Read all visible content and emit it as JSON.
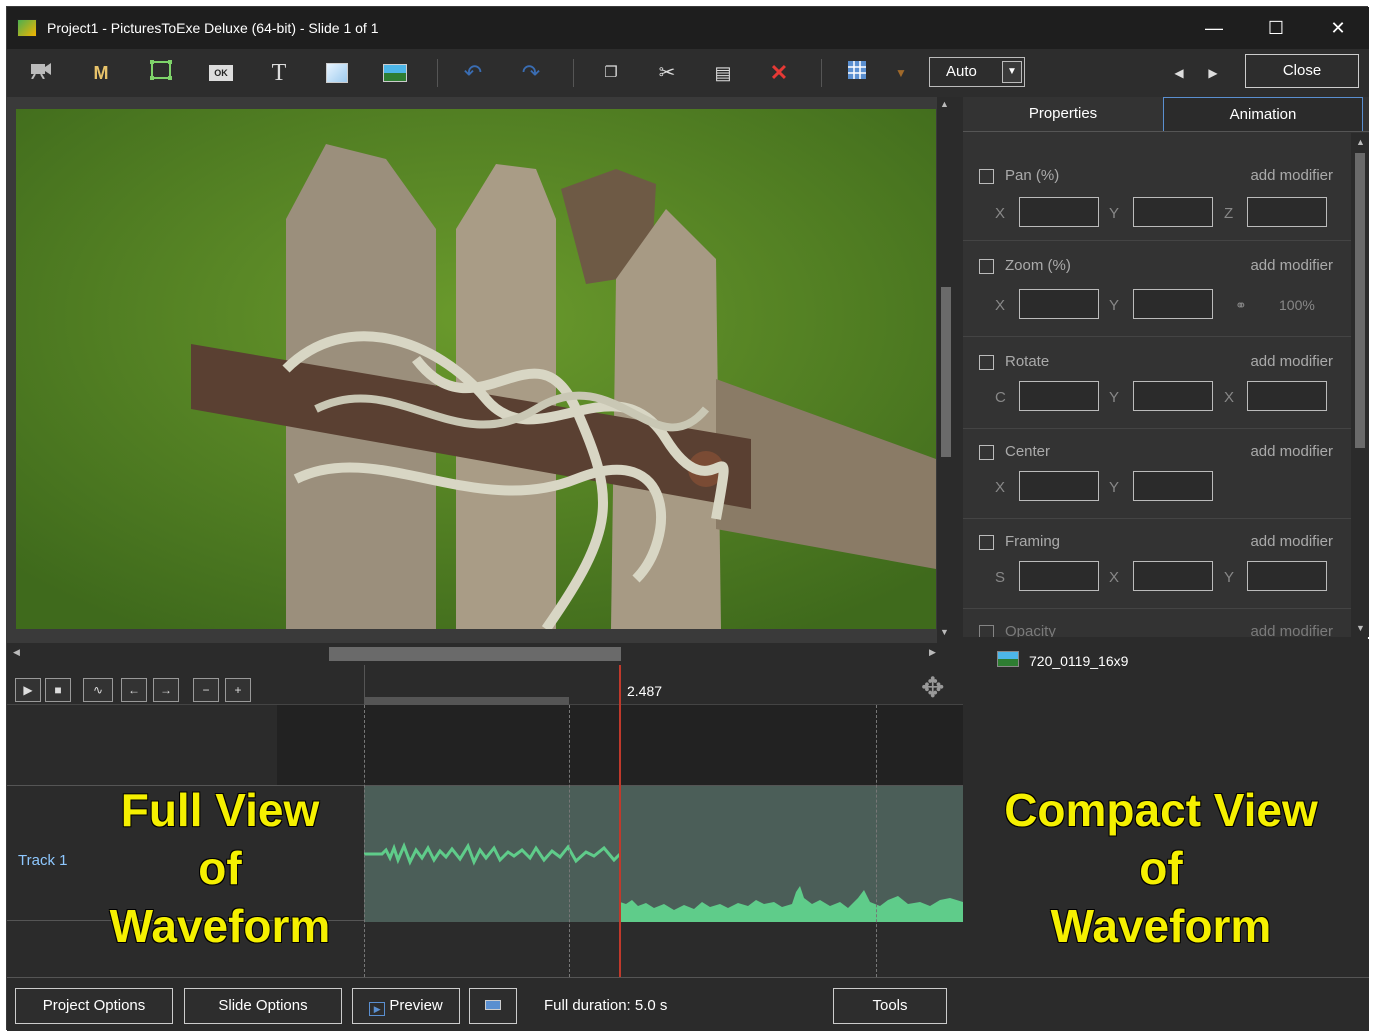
{
  "window": {
    "title": "Project1 - PicturesToExe Deluxe (64-bit) - Slide 1 of 1"
  },
  "toolbar": {
    "tools": [
      "camera-icon",
      "m-icon",
      "frame-icon",
      "ok-button-icon",
      "text-icon",
      "rectangle-icon",
      "image-icon",
      "undo-icon",
      "redo-icon",
      "copy-icon",
      "cut-icon",
      "paste-icon",
      "delete-icon",
      "grid-icon",
      "dropdown-icon"
    ],
    "text_tool_label": "T",
    "m_label": "M",
    "ok_label": "OK",
    "zoom_value": "Auto",
    "close_label": "Close"
  },
  "right_panel": {
    "tabs": [
      "Properties",
      "Animation"
    ],
    "active_tab": "Animation",
    "groups": [
      {
        "label": "Pan (%)",
        "modifier": "add modifier",
        "axes": [
          "X",
          "Y",
          "Z"
        ]
      },
      {
        "label": "Zoom (%)",
        "modifier": "add modifier",
        "axes": [
          "X",
          "Y"
        ],
        "link_value": "100%"
      },
      {
        "label": "Rotate",
        "modifier": "add modifier",
        "axes": [
          "C",
          "Y",
          "X"
        ]
      },
      {
        "label": "Center",
        "modifier": "add modifier",
        "axes": [
          "X",
          "Y"
        ]
      },
      {
        "label": "Framing",
        "modifier": "add modifier",
        "axes": [
          "S",
          "X",
          "Y"
        ]
      },
      {
        "label": "Opacity",
        "modifier": "add modifier"
      }
    ]
  },
  "object_list": {
    "item": "720_0119_16x9"
  },
  "timeline": {
    "current_time": "2.487",
    "track_label": "Track 1"
  },
  "annotations": {
    "full_view": [
      "Full View",
      "of",
      "Waveform"
    ],
    "compact_view": [
      "Compact View",
      "of",
      "Waveform"
    ]
  },
  "bottom": {
    "project_options": "Project Options",
    "slide_options": "Slide Options",
    "preview": "Preview",
    "duration": "Full duration: 5.0 s",
    "tools": "Tools"
  },
  "colors": {
    "annotation": "#f5f000",
    "playhead": "#c0392b",
    "waveform": "#5fcc8a"
  }
}
